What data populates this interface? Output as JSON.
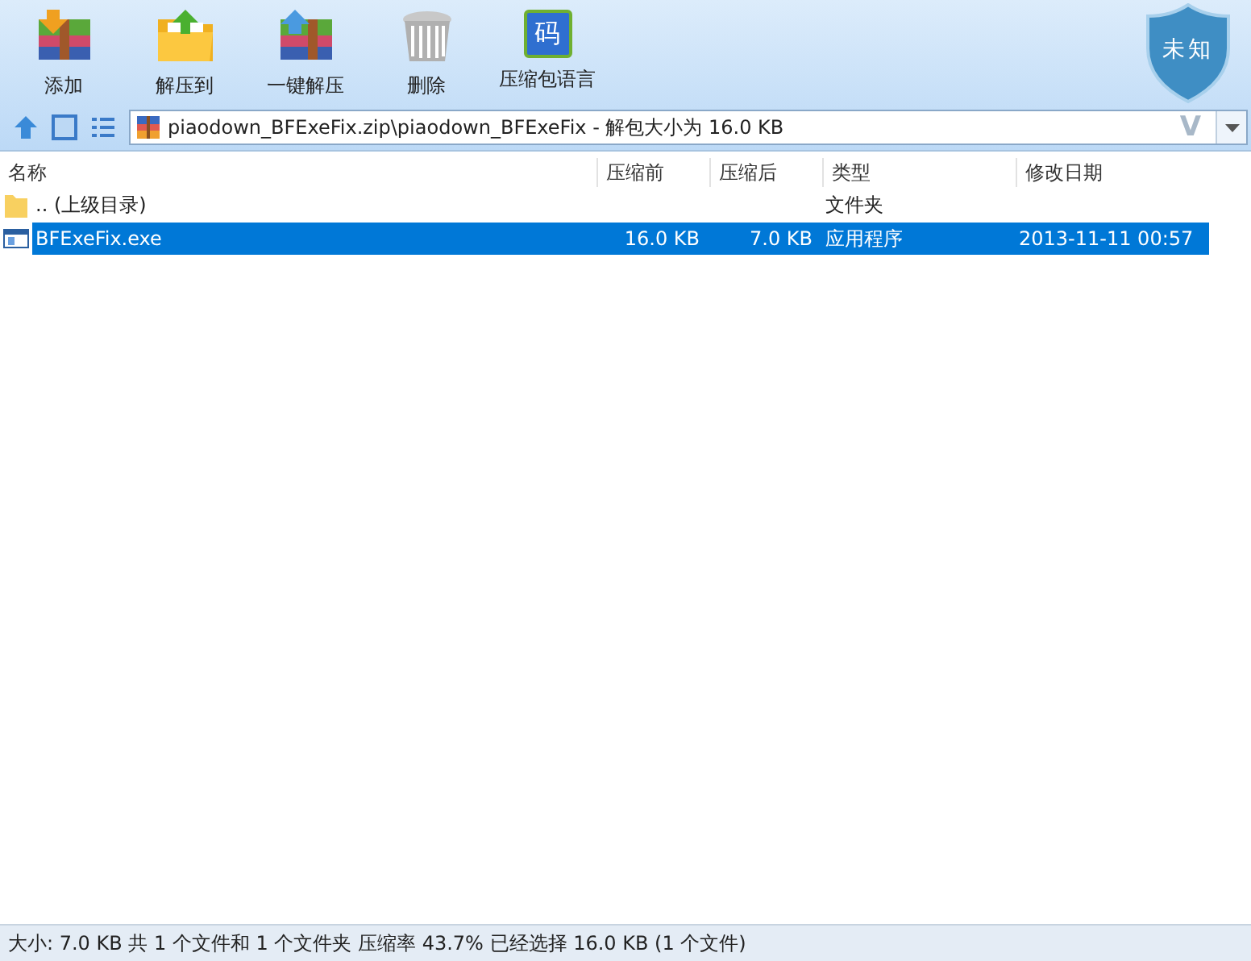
{
  "toolbar": {
    "buttons": [
      {
        "kind": "add",
        "label": "添加"
      },
      {
        "kind": "extract",
        "label": "解压到"
      },
      {
        "kind": "oneclick",
        "label": "一键解压"
      },
      {
        "kind": "delete",
        "label": "删除"
      },
      {
        "kind": "language",
        "label": "压缩包语言",
        "icon_text": "码"
      }
    ],
    "badge": {
      "label": "未知"
    }
  },
  "address": {
    "path": "piaodown_BFExeFix.zip\\piaodown_BFExeFix - 解包大小为 16.0 KB",
    "logo": "V"
  },
  "table": {
    "columns": [
      "名称",
      "压缩前",
      "压缩后",
      "类型",
      "修改日期"
    ],
    "rows": [
      {
        "kind": "folder",
        "name": ".. (上级目录)",
        "size": "",
        "packed": "",
        "type": "文件夹",
        "modified": "",
        "selected": false
      },
      {
        "kind": "exe",
        "name": "BFExeFix.exe",
        "size": "16.0 KB",
        "packed": "7.0 KB",
        "type": "应用程序",
        "modified": "2013-11-11 00:57",
        "selected": true
      }
    ]
  },
  "status_bar": "大小: 7.0 KB 共 1 个文件和 1 个文件夹 压缩率 43.7% 已经选择 16.0 KB (1 个文件)"
}
